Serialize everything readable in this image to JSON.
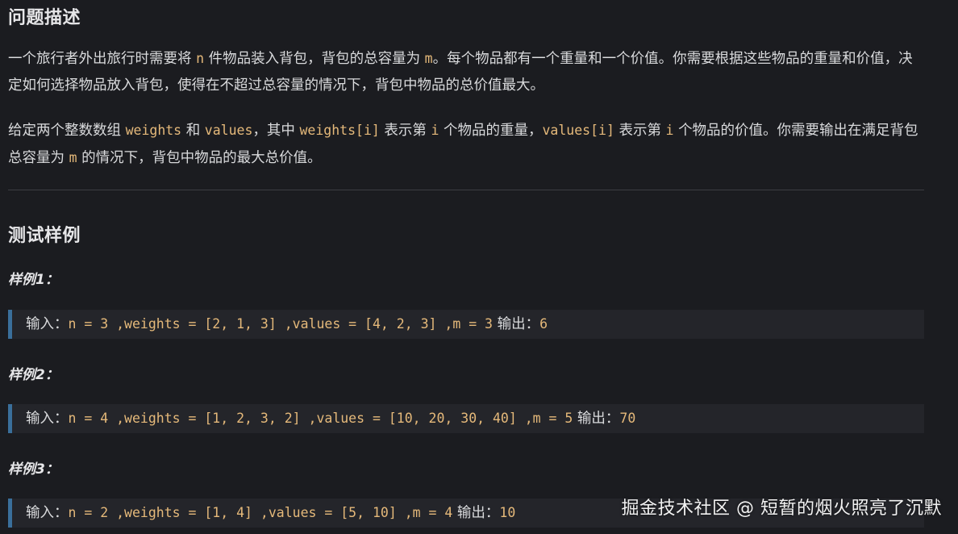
{
  "section1": {
    "title": "问题描述",
    "p1": {
      "t1": "一个旅行者外出旅行时需要将",
      "c1": "n",
      "t2": "件物品装入背包，背包的总容量为",
      "c2": "m",
      "t3": "。每个物品都有一个重量和一个价值。你需要根据这些物品的重量和价值，决定如何选择物品放入背包，使得在不超过总容量的情况下，背包中物品的总价值最大。"
    },
    "p2": {
      "t1": "给定两个整数数组",
      "c1": "weights",
      "t2": "和",
      "c2": "values",
      "t3": "，其中",
      "c3": "weights[i]",
      "t4": "表示第",
      "c4": "i",
      "t5": "个物品的重量，",
      "c5": "values[i]",
      "t6": "表示第",
      "c6": "i",
      "t7": "个物品的价值。你需要输出在满足背包总容量为",
      "c7": "m",
      "t8": "的情况下，背包中物品的最大总价值。"
    }
  },
  "section2": {
    "title": "测试样例",
    "samples": [
      {
        "label": "样例1：",
        "input_label": "输入：",
        "input_code": "n = 3 ,weights = [2, 1, 3] ,values = [4, 2, 3] ,m = 3",
        "output_label": "输出：",
        "output_code": "6"
      },
      {
        "label": "样例2：",
        "input_label": "输入：",
        "input_code": "n = 4 ,weights = [1, 2, 3, 2] ,values = [10, 20, 30, 40] ,m = 5",
        "output_label": "输出：",
        "output_code": "70"
      },
      {
        "label": "样例3：",
        "input_label": "输入：",
        "input_code": "n = 2 ,weights = [1, 4] ,values = [5, 10] ,m = 4",
        "output_label": "输出：",
        "output_code": "10"
      }
    ]
  },
  "watermark": "掘金技术社区 @ 短暂的烟火照亮了沉默",
  "colors": {
    "background": "#1b1c20",
    "code": "#e5b97a",
    "block_border": "#3a6f9b",
    "block_bg": "#24252a"
  }
}
